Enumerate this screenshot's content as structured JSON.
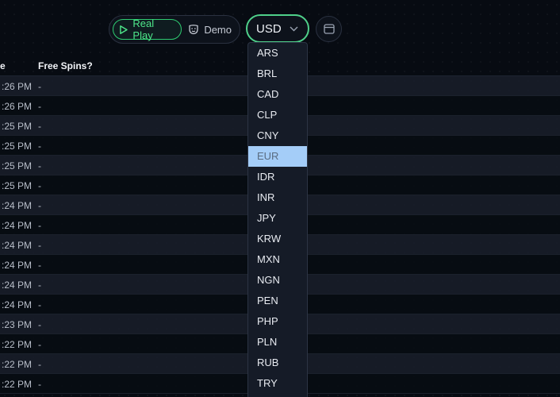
{
  "toolbar": {
    "real_play_label": "Real Play",
    "demo_label": "Demo",
    "currency_value": "USD"
  },
  "table": {
    "headers": {
      "time": "e",
      "free_spins": "Free Spins?"
    },
    "rows": [
      {
        "time": ":26 PM",
        "free_spins": "-"
      },
      {
        "time": ":26 PM",
        "free_spins": "-"
      },
      {
        "time": ":25 PM",
        "free_spins": "-"
      },
      {
        "time": ":25 PM",
        "free_spins": "-"
      },
      {
        "time": ":25 PM",
        "free_spins": "-"
      },
      {
        "time": ":25 PM",
        "free_spins": "-"
      },
      {
        "time": ":24 PM",
        "free_spins": "-"
      },
      {
        "time": ":24 PM",
        "free_spins": "-"
      },
      {
        "time": ":24 PM",
        "free_spins": "-"
      },
      {
        "time": ":24 PM",
        "free_spins": "-"
      },
      {
        "time": ":24 PM",
        "free_spins": "-"
      },
      {
        "time": ":24 PM",
        "free_spins": "-"
      },
      {
        "time": ":23 PM",
        "free_spins": "-"
      },
      {
        "time": ":22 PM",
        "free_spins": "-"
      },
      {
        "time": ":22 PM",
        "free_spins": "-"
      },
      {
        "time": ":22 PM",
        "free_spins": "-"
      }
    ]
  },
  "currency_dropdown": {
    "options": [
      "ARS",
      "BRL",
      "CAD",
      "CLP",
      "CNY",
      "EUR",
      "IDR",
      "INR",
      "JPY",
      "KRW",
      "MXN",
      "NGN",
      "PEN",
      "PHP",
      "PLN",
      "RUB",
      "TRY"
    ],
    "highlighted": "EUR"
  },
  "icons": {
    "real_play": "play-icon",
    "demo": "mask-icon",
    "currency_chevron": "chevron-down-icon",
    "window": "window-icon"
  },
  "colors": {
    "accent_green": "#2ecc71",
    "highlight_blue": "#a4cdf8"
  }
}
